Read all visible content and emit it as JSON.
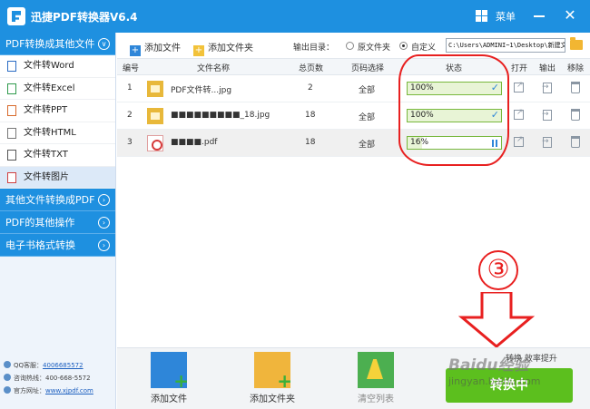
{
  "titlebar": {
    "title": "迅捷PDF转换器V6.4",
    "menu_label": "菜单",
    "close_glyph": "✕"
  },
  "sidebar": {
    "categories": [
      {
        "label": "PDF转换成其他文件",
        "chevron": "∨"
      },
      {
        "label": "其他文件转换成PDF",
        "chevron": "›"
      },
      {
        "label": "PDF的其他操作",
        "chevron": "›"
      },
      {
        "label": "电子书格式转换",
        "chevron": "›"
      }
    ],
    "items": [
      {
        "label": "文件转Word",
        "icon": "word-icon"
      },
      {
        "label": "文件转Excel",
        "icon": "excel-icon"
      },
      {
        "label": "文件转PPT",
        "icon": "ppt-icon"
      },
      {
        "label": "文件转HTML",
        "icon": "html-icon"
      },
      {
        "label": "文件转TXT",
        "icon": "txt-icon"
      },
      {
        "label": "文件转图片",
        "icon": "image-icon"
      }
    ],
    "contacts": {
      "qq_label": "QQ客服：",
      "qq_value": "4006685572",
      "phone_label": "咨询热线：",
      "phone_value": "400-668-5572",
      "site_label": "官方网址：",
      "site_value": "www.xjpdf.com"
    }
  },
  "toolbar": {
    "add_file": "添加文件",
    "add_folder": "添加文件夹",
    "output_label": "输出目录：",
    "radio_original": "原文件夹",
    "radio_custom": "自定义",
    "output_path": "C:\\Users\\ADMINI~1\\Desktop\\新建文"
  },
  "table": {
    "headers": {
      "num": "编号",
      "name": "文件名称",
      "pages": "总页数",
      "page_select": "页码选择",
      "status": "状态",
      "open": "打开",
      "output": "输出",
      "remove": "移除"
    },
    "rows": [
      {
        "num": "1",
        "name": "PDF文件转...jpg",
        "pages": "2",
        "page_select": "全部",
        "progress": "100%",
        "progress_value": 1.0
      },
      {
        "num": "2",
        "name": "■■■■■■■■■_18.jpg",
        "pages": "18",
        "page_select": "全部",
        "progress": "100%",
        "progress_value": 1.0
      },
      {
        "num": "3",
        "name": "■■■■.pdf",
        "pages": "18",
        "page_select": "全部",
        "progress": "16%",
        "progress_value": 0.16
      }
    ]
  },
  "annotation": {
    "step": "③"
  },
  "bottom": {
    "add_file": "添加文件",
    "add_folder": "添加文件夹",
    "clear_list": "清空列表",
    "note": "转换 效率提升",
    "convert_button": "转换中"
  },
  "watermark": {
    "line1": "Baidu经验",
    "line2": "jingyan.baidu.com"
  },
  "colors": {
    "primary": "#1e90e0",
    "progress_border": "#78b83d",
    "convert_green": "#5cbf1e",
    "annotation_red": "#e82020"
  }
}
